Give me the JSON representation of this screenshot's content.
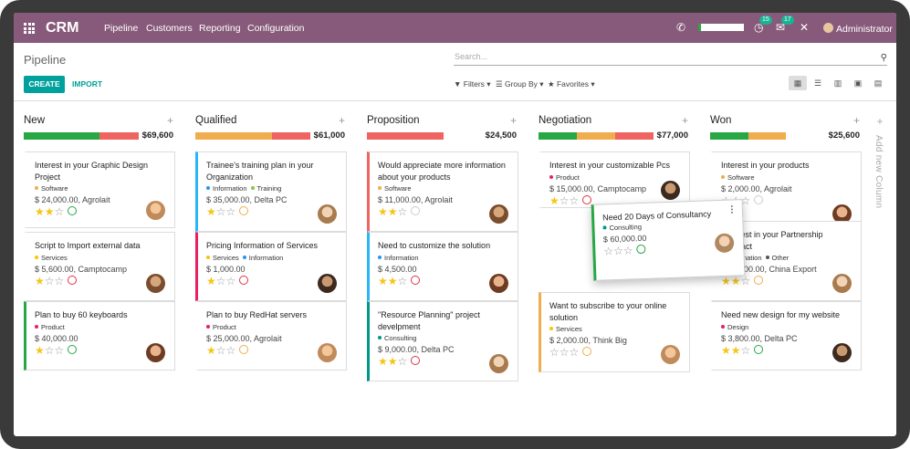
{
  "nav": {
    "brand": "CRM",
    "menu": [
      "Pipeline",
      "Customers",
      "Reporting",
      "Configuration"
    ],
    "badge1": "15",
    "badge2": "17",
    "user": "Administrator"
  },
  "control": {
    "title": "Pipeline",
    "search_placeholder": "Search...",
    "create": "CREATE",
    "import": "IMPORT",
    "filters": "Filters",
    "group_by": "Group By",
    "favorites": "Favorites"
  },
  "add_column": "Add new Column",
  "colors": {
    "nav": "#875a7b",
    "accent": "#00a09d",
    "green": "#28a745",
    "orange": "#f0ad4e",
    "red": "#ef6461",
    "blue": "#2196f3",
    "pink": "#e91e63"
  },
  "columns": [
    {
      "title": "New",
      "amount": "$69,600",
      "progress": [
        {
          "color": "#28a745",
          "frac": 0.66
        },
        {
          "color": "#ef6461",
          "frac": 0.34
        }
      ],
      "cards": [
        {
          "title": "Interest in your Graphic Design Project",
          "tags": [
            {
              "label": "Software",
              "color": "#f0ad4e"
            }
          ],
          "money": "$ 24,000.00, Agrolait",
          "stars": 2,
          "activity": "green",
          "border": ""
        },
        {
          "title": "Script to Import external data",
          "tags": [
            {
              "label": "Services",
              "color": "#ffc107"
            }
          ],
          "money": "$ 5,600.00, Camptocamp",
          "stars": 1,
          "activity": "red",
          "border": ""
        },
        {
          "title": "Plan to buy 60 keyboards",
          "tags": [
            {
              "label": "Product",
              "color": "#e91e63"
            }
          ],
          "money": "$ 40,000.00",
          "stars": 1,
          "activity": "green",
          "border": "#28a745"
        }
      ]
    },
    {
      "title": "Qualified",
      "amount": "$61,000",
      "progress": [
        {
          "color": "#f0ad4e",
          "frac": 0.67
        },
        {
          "color": "#ef6461",
          "frac": 0.33
        }
      ],
      "cards": [
        {
          "title": "Trainee's training plan in your Organization",
          "tags": [
            {
              "label": "Information",
              "color": "#2196f3"
            },
            {
              "label": "Training",
              "color": "#8bc34a"
            }
          ],
          "money": "$ 35,000.00, Delta PC",
          "stars": 1,
          "activity": "orange",
          "border": "#29b6f6"
        },
        {
          "title": "Pricing Information of Services",
          "tags": [
            {
              "label": "Services",
              "color": "#ffc107"
            },
            {
              "label": "Information",
              "color": "#2196f3"
            }
          ],
          "money": "$ 1,000.00",
          "stars": 1,
          "activity": "red",
          "border": "#e91e63"
        },
        {
          "title": "Plan to buy RedHat servers",
          "tags": [
            {
              "label": "Product",
              "color": "#e91e63"
            }
          ],
          "money": "$ 25,000.00, Agrolait",
          "stars": 1,
          "activity": "orange",
          "border": ""
        }
      ]
    },
    {
      "title": "Proposition",
      "amount": "$24,500",
      "progress": [
        {
          "color": "#ef6461",
          "frac": 0.67
        }
      ],
      "cards": [
        {
          "title": "Would appreciate more information about your products",
          "tags": [
            {
              "label": "Software",
              "color": "#f0ad4e"
            }
          ],
          "money": "$ 11,000.00, Agrolait",
          "stars": 2,
          "activity": "grey",
          "border": "#ef6461"
        },
        {
          "title": "Need to customize the solution",
          "tags": [
            {
              "label": "Information",
              "color": "#2196f3"
            }
          ],
          "money": "$ 4,500.00",
          "stars": 2,
          "activity": "red",
          "border": "#29b6f6"
        },
        {
          "title": "\"Resource Planning\" project develpment",
          "tags": [
            {
              "label": "Consulting",
              "color": "#009688"
            }
          ],
          "money": "$ 9,000.00, Delta PC",
          "stars": 2,
          "activity": "red",
          "border": "#009688"
        }
      ]
    },
    {
      "title": "Negotiation",
      "amount": "$77,000",
      "progress": [
        {
          "color": "#28a745",
          "frac": 0.33
        },
        {
          "color": "#f0ad4e",
          "frac": 0.34
        },
        {
          "color": "#ef6461",
          "frac": 0.33
        }
      ],
      "cards": [
        {
          "title": "Interest in your customizable Pcs",
          "tags": [
            {
              "label": "Product",
              "color": "#e91e63"
            }
          ],
          "money": "$ 15,000.00, Camptocamp",
          "stars": 1,
          "activity": "red",
          "border": ""
        },
        {
          "title": "Want to subscribe to your online solution",
          "tags": [
            {
              "label": "Services",
              "color": "#ffc107"
            }
          ],
          "money": "$ 2,000.00, Think Big",
          "stars": 0,
          "activity": "orange",
          "border": "#f0ad4e"
        }
      ]
    },
    {
      "title": "Won",
      "amount": "$25,600",
      "progress": [
        {
          "color": "#28a745",
          "frac": 0.33
        },
        {
          "color": "#f0ad4e",
          "frac": 0.33
        }
      ],
      "cards": [
        {
          "title": "Interest in your products",
          "tags": [
            {
              "label": "Software",
              "color": "#f0ad4e"
            }
          ],
          "money": "$ 2,000.00, Agrolait",
          "stars": 0,
          "activity": "grey",
          "border": ""
        },
        {
          "title": "Request in your Partnership Contract",
          "tags": [
            {
              "label": "Information",
              "color": "#2196f3"
            },
            {
              "label": "Other",
              "color": "#555"
            }
          ],
          "money": "$ 19,800.00, China Export",
          "stars": 2,
          "activity": "orange",
          "border": ""
        },
        {
          "title": "Need new design for my website",
          "tags": [
            {
              "label": "Design",
              "color": "#e91e63"
            }
          ],
          "money": "$ 3,800.00, Delta PC",
          "stars": 2,
          "activity": "green",
          "border": ""
        }
      ]
    }
  ],
  "dragging": {
    "title": "Need 20 Days of Consultancy",
    "tags": [
      {
        "label": "Consulting",
        "color": "#009688"
      }
    ],
    "money": "$ 60,000.00",
    "stars": 0,
    "activity": "green"
  }
}
